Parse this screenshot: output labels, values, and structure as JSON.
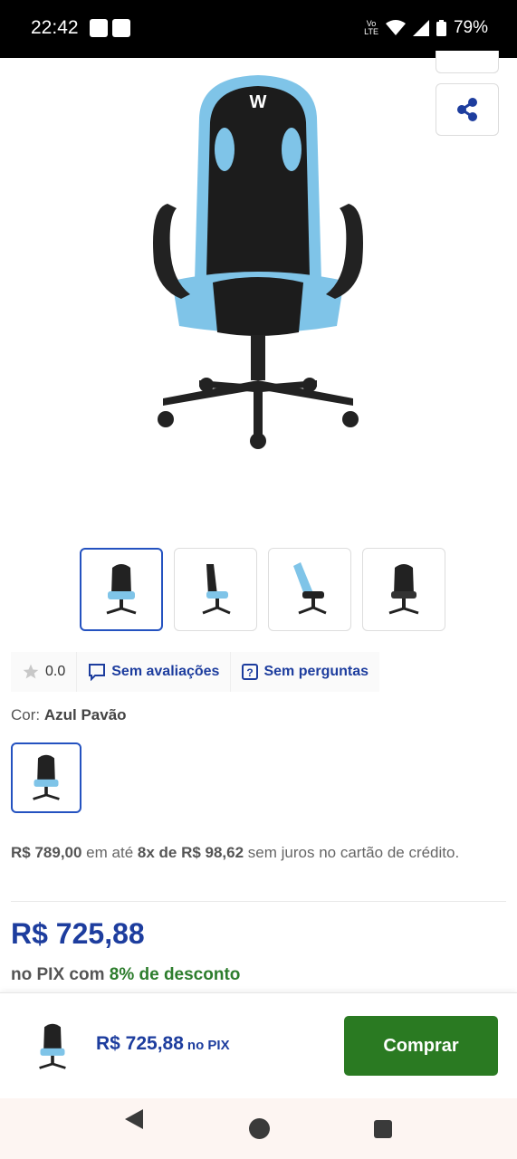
{
  "status_bar": {
    "time": "22:42",
    "network": "Vo LTE",
    "battery": "79%"
  },
  "product": {
    "hero_image": "gaming-chair-blue-black",
    "thumbnails": [
      "chair-front",
      "chair-side",
      "chair-reclined",
      "chair-back"
    ]
  },
  "rating": {
    "score": "0.0",
    "reviews_label": "Sem avaliações",
    "questions_label": "Sem perguntas"
  },
  "color": {
    "label": "Cor:",
    "value": "Azul Pavão"
  },
  "installments": {
    "full_price": "R$ 789,00",
    "text1": " em até ",
    "plan": "8x de R$ 98,62",
    "text2": " sem juros no cartão de crédito."
  },
  "pix": {
    "price": "R$ 725,88",
    "prefix": "no PIX com ",
    "discount": "8% de desconto"
  },
  "bottom_bar": {
    "price": "R$ 725,88",
    "pix_label": "no PIX",
    "buy_label": "Comprar"
  },
  "colors": {
    "brand_blue": "#1d3d9e",
    "buy_green": "#2a7a22",
    "discount_green": "#2d7d2d"
  }
}
